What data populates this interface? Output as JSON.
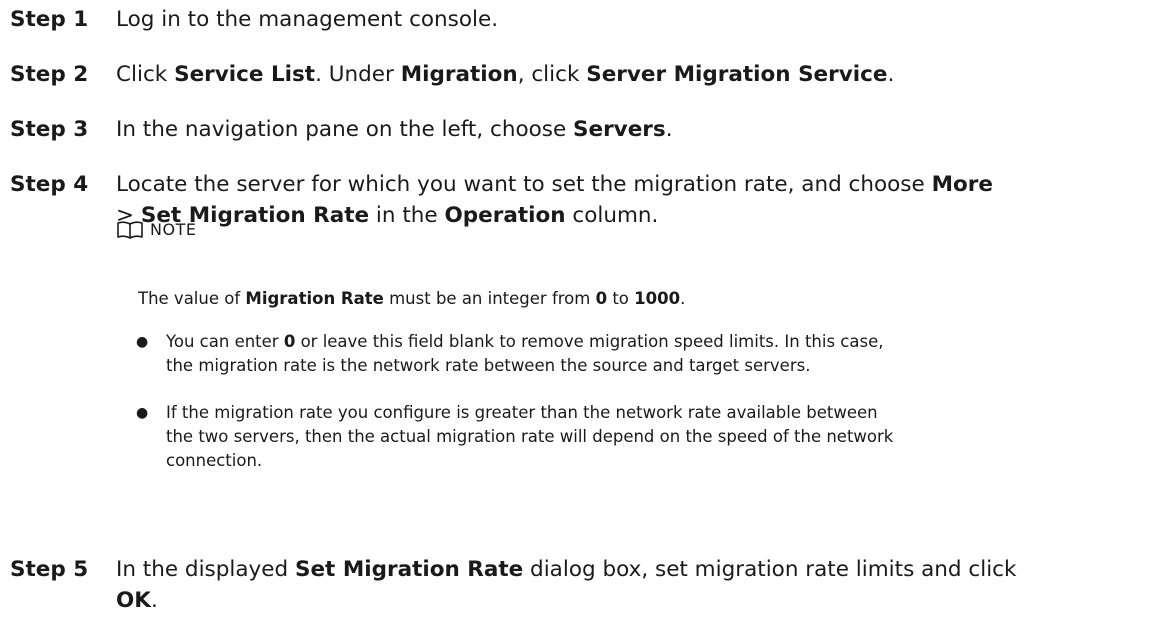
{
  "steps": [
    {
      "label": "Step 1",
      "lines": [
        [
          {
            "t": "Log in to the management console.",
            "b": false
          }
        ]
      ]
    },
    {
      "label": "Step 2",
      "lines": [
        [
          {
            "t": "Click ",
            "b": false
          },
          {
            "t": "Service List",
            "b": true
          },
          {
            "t": ". Under ",
            "b": false
          },
          {
            "t": "Migration",
            "b": true
          },
          {
            "t": ", click ",
            "b": false
          },
          {
            "t": "Server Migration Service",
            "b": true
          },
          {
            "t": ".",
            "b": false
          }
        ]
      ]
    },
    {
      "label": "Step 3",
      "lines": [
        [
          {
            "t": "In the navigation pane on the left, choose ",
            "b": false
          },
          {
            "t": "Servers",
            "b": true
          },
          {
            "t": ".",
            "b": false
          }
        ]
      ]
    },
    {
      "label": "Step 4",
      "lines": [
        [
          {
            "t": "Locate the server for which you want to set the migration rate, and choose ",
            "b": false
          },
          {
            "t": "More",
            "b": true
          }
        ],
        [
          {
            "t": "> ",
            "b": false
          },
          {
            "t": "Set Migration Rate",
            "b": true
          },
          {
            "t": " in the ",
            "b": false
          },
          {
            "t": "Operation",
            "b": true
          },
          {
            "t": " column.",
            "b": false
          }
        ]
      ]
    },
    {
      "label": "Step 5",
      "lines": [
        [
          {
            "t": "In the displayed ",
            "b": false
          },
          {
            "t": "Set Migration Rate",
            "b": true
          },
          {
            "t": " dialog box, set migration rate limits and click",
            "b": false
          }
        ],
        [
          {
            "t": "OK",
            "b": true
          },
          {
            "t": ".",
            "b": false
          }
        ]
      ]
    }
  ],
  "note": {
    "icon": "book-icon",
    "title": "NOTE",
    "intro": [
      {
        "t": "The value of ",
        "b": false
      },
      {
        "t": "Migration Rate",
        "b": true
      },
      {
        "t": " must be an integer from ",
        "b": false
      },
      {
        "t": "0",
        "b": true
      },
      {
        "t": " to ",
        "b": false
      },
      {
        "t": "1000",
        "b": true
      },
      {
        "t": ".",
        "b": false
      }
    ],
    "bullets": [
      {
        "lines": [
          [
            {
              "t": "You can enter ",
              "b": false
            },
            {
              "t": "0",
              "b": true
            },
            {
              "t": " or leave this field blank to remove migration speed limits. In this case,",
              "b": false
            }
          ],
          [
            {
              "t": "the migration rate is the network rate between the source and target servers.",
              "b": false
            }
          ]
        ]
      },
      {
        "lines": [
          [
            {
              "t": "If the migration rate you configure is greater than the network rate available between",
              "b": false
            }
          ],
          [
            {
              "t": "the two servers, then the actual migration rate will depend on the speed of the network",
              "b": false
            }
          ],
          [
            {
              "t": "connection.",
              "b": false
            }
          ]
        ]
      }
    ]
  }
}
